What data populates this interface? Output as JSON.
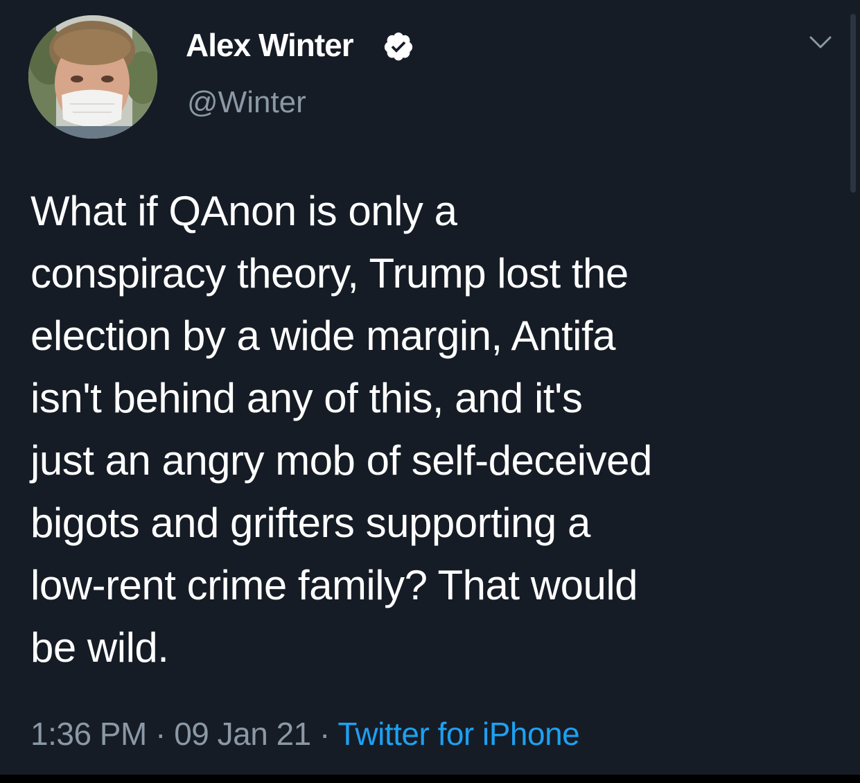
{
  "author": {
    "name": "Alex Winter",
    "handle": "@Winter",
    "verified": true
  },
  "icons": {
    "verified": "verified-badge-icon",
    "menu": "chevron-down-icon",
    "avatar": "profile-photo"
  },
  "tweet": {
    "lines": [
      "What if QAnon is only a",
      "conspiracy theory, Trump lost the",
      "election by a wide margin, Antifa",
      "isn't behind any of this, and it's",
      "just an angry mob of self-deceived",
      "bigots and grifters supporting a",
      "low-rent crime family? That would",
      "be wild."
    ]
  },
  "meta": {
    "time": "1:36 PM",
    "separator": " · ",
    "date": "09 Jan 21",
    "source": "Twitter for iPhone"
  },
  "colors": {
    "background": "#161c25",
    "text": "#ffffff",
    "muted": "#8b98a5",
    "link": "#1da1f2"
  }
}
